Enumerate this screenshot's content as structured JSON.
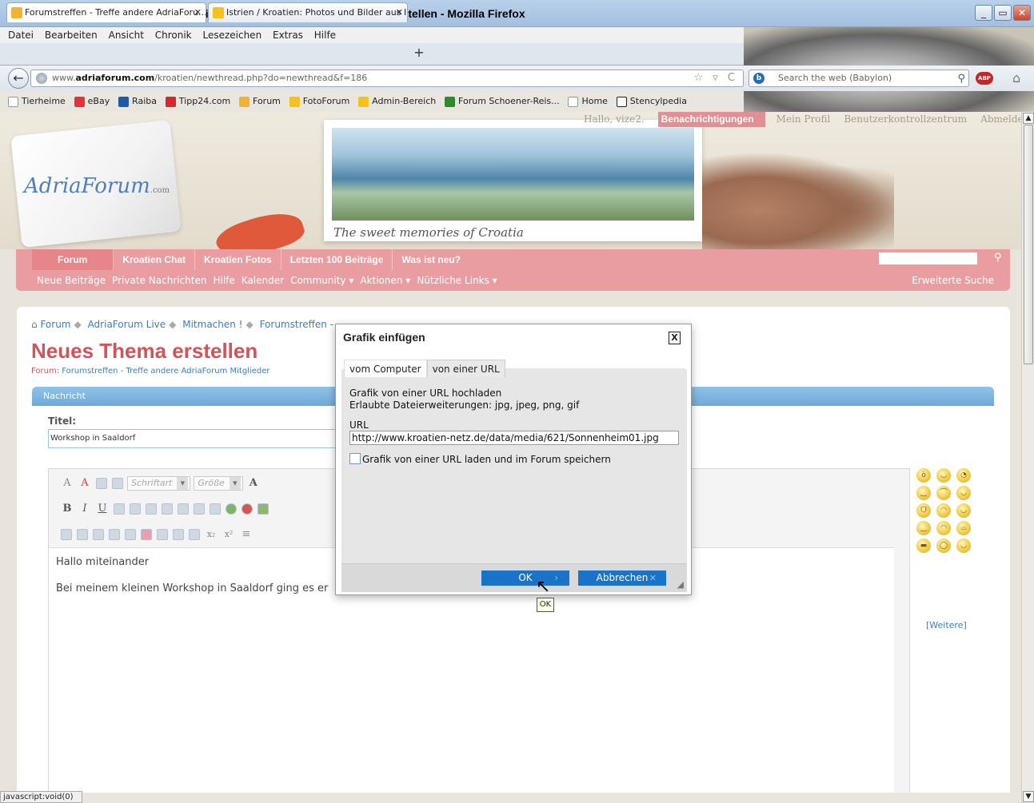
{
  "window": {
    "title": "Forumstreffen - Treffe andere AdriaForum Mitglieder - Neues Thema erstellen - Mozilla Firefox",
    "min": "_",
    "max": "▭",
    "close": "✕"
  },
  "menubar": [
    "Datei",
    "Bearbeiten",
    "Ansicht",
    "Chronik",
    "Lesezeichen",
    "Extras",
    "Hilfe"
  ],
  "tabs": [
    {
      "label": "Forumstreffen - Treffe andere AdriaForu...",
      "close": "✕",
      "icon_color": "#f2b233"
    },
    {
      "label": "Istrien / Kroatien: Photos und Bilder aus I...",
      "close": "✕",
      "icon_color": "#f4c21c"
    }
  ],
  "newtab": "+",
  "navbar": {
    "back": "←",
    "url_prefix": "www.",
    "url_domain": "adriaforum.com",
    "url_path": "/kroatien/newthread.php?do=newthread&f=186",
    "url_tools": "☆ ▿ C",
    "search_placeholder": "Search the web (Babylon)",
    "search_engine_icon": "b",
    "mag": "⚲",
    "abp": "ABP",
    "home": "⌂"
  },
  "bookmarks": [
    {
      "label": "Tierheime",
      "color": "#ffffff"
    },
    {
      "label": "eBay",
      "color": "#e53238"
    },
    {
      "label": "Raiba",
      "color": "#1c5aa6"
    },
    {
      "label": "Tipp24.com",
      "color": "#d6262e"
    },
    {
      "label": "Forum",
      "color": "#f2b233"
    },
    {
      "label": "FotoForum",
      "color": "#f4c21c"
    },
    {
      "label": "Admin-Bereich",
      "color": "#f4c21c"
    },
    {
      "label": "Forum Schoener-Reis...",
      "color": "#2f8a2f"
    },
    {
      "label": "Home",
      "color": "#ffffff"
    },
    {
      "label": "Stencylpedia",
      "color": "#222222"
    }
  ],
  "header": {
    "user_greeting": "Hallo, vize2.",
    "notifications": "Benachrichtigungen",
    "profile": "Mein Profil",
    "usercp": "Benutzerkontrollzentrum",
    "logout": "Abmelden",
    "logo": "AdriaForum",
    "logo_suffix": ".com",
    "postcard_caption": "The sweet memories of Croatia"
  },
  "nav": {
    "primary": [
      "Forum",
      "Kroatien Chat",
      "Kroatien Fotos",
      "Letzten 100 Beiträge",
      "Was ist neu?"
    ],
    "secondary": [
      "Neue Beiträge",
      "Private Nachrichten",
      "Hilfe",
      "Kalender",
      "Community ▾",
      "Aktionen ▾",
      "Nützliche Links ▾"
    ],
    "advanced_search": "Erweiterte Suche",
    "search_icon": "⚲"
  },
  "breadcrumb": [
    "Forum",
    "AdriaForum Live",
    "Mitmachen !",
    "Forumstreffen -"
  ],
  "page": {
    "title": "Neues Thema erstellen",
    "forum_label": "Forum:",
    "forum_name": "Forumstreffen - Treffe andere AdriaForum Mitglieder",
    "section": "Nachricht",
    "title_label": "Titel:",
    "title_value": "Workshop in Saaldorf"
  },
  "editor": {
    "font_select": "Schriftart",
    "size_select": "Größe",
    "body_line1": "Hallo miteinander",
    "body_line2": "Bei meinem kleinen Workshop in Saaldorf ging es er",
    "more_smilies": "[Weitere]"
  },
  "dialog": {
    "title": "Grafik einfügen",
    "close": "X",
    "tab_computer": "vom Computer",
    "tab_url": "von einer URL",
    "info_line1": "Grafik von einer URL hochladen",
    "info_line2": "Erlaubte Dateierweiterungen: jpg, jpeg, png, gif",
    "url_label": "URL",
    "url_value": "http://www.kroatien-netz.de/data/media/621/Sonnenheim01.jpg",
    "checkbox_label": "Grafik von einer URL laden und im Forum speichern",
    "ok": "OK",
    "ok_chev": "›",
    "cancel": "Abbrechen",
    "cancel_x": "✕",
    "tooltip": "OK"
  },
  "status": "javascript:void(0)"
}
